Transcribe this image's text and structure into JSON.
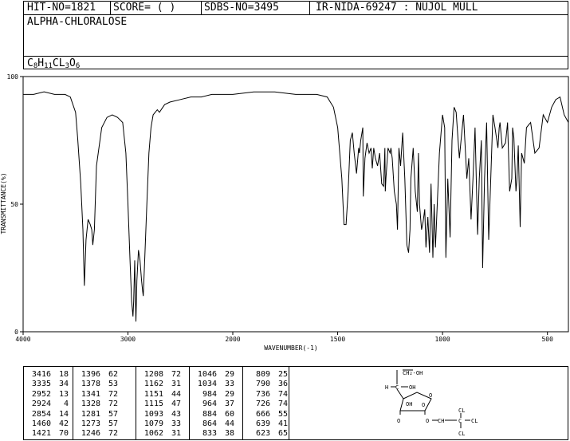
{
  "header": {
    "hit_no": "HIT-NO=1821",
    "score": "SCORE=  (   )",
    "sdbs_no": "SDBS-NO=3495",
    "ir_nida": "IR-NIDA-69247 : NUJOL MULL",
    "compound_name": "ALPHA-CHLORALOSE",
    "formula": {
      "c": "C",
      "c_n": "8",
      "h": "H",
      "h_n": "11",
      "cl": "CL",
      "cl_n": "3",
      "o": "O",
      "o_n": "6"
    }
  },
  "chart_data": {
    "type": "line",
    "title": "",
    "xlabel": "WAVENUMBER(-1)",
    "ylabel": "TRANSMITTANCE(%)",
    "xlim": [
      4000,
      400
    ],
    "ylim": [
      0,
      100
    ],
    "x_ticks": [
      4000,
      3000,
      2000,
      1500,
      1000,
      500
    ],
    "y_ticks": [
      0,
      50,
      100
    ],
    "grid": false,
    "series": [
      {
        "x": [
          4000,
          3900,
          3800,
          3700,
          3600,
          3550,
          3500,
          3480,
          3450,
          3430,
          3416,
          3400,
          3380,
          3360,
          3345,
          3335,
          3320,
          3300,
          3250,
          3200,
          3150,
          3100,
          3050,
          3020,
          3000,
          2980,
          2965,
          2952,
          2945,
          2935,
          2930,
          2924,
          2915,
          2900,
          2885,
          2870,
          2860,
          2854,
          2840,
          2820,
          2800,
          2780,
          2760,
          2720,
          2700,
          2650,
          2600,
          2500,
          2400,
          2300,
          2200,
          2100,
          2000,
          1900,
          1800,
          1700,
          1600,
          1550,
          1520,
          1500,
          1480,
          1470,
          1460,
          1450,
          1440,
          1430,
          1421,
          1410,
          1400,
          1396,
          1390,
          1380,
          1378,
          1370,
          1360,
          1350,
          1341,
          1335,
          1328,
          1320,
          1310,
          1300,
          1290,
          1281,
          1275,
          1273,
          1270,
          1260,
          1250,
          1246,
          1240,
          1230,
          1220,
          1215,
          1208,
          1200,
          1190,
          1180,
          1170,
          1162,
          1155,
          1151,
          1140,
          1130,
          1120,
          1115,
          1110,
          1100,
          1093,
          1085,
          1079,
          1070,
          1062,
          1055,
          1046,
          1040,
          1034,
          1025,
          1015,
          1000,
          990,
          984,
          975,
          964,
          955,
          945,
          935,
          920,
          900,
          884,
          875,
          864,
          855,
          845,
          833,
          825,
          815,
          809,
          800,
          790,
          780,
          770,
          760,
          750,
          736,
          730,
          726,
          715,
          700,
          690,
          680,
          670,
          666,
          660,
          650,
          645,
          639,
          630,
          623,
          610,
          600,
          580,
          560,
          540,
          520,
          500,
          480,
          460,
          440,
          420,
          400
        ],
        "y": [
          93,
          93,
          94,
          93,
          93,
          92,
          86,
          76,
          58,
          40,
          18,
          36,
          44,
          42,
          40,
          34,
          40,
          65,
          80,
          84,
          85,
          84,
          82,
          70,
          50,
          28,
          12,
          6,
          12,
          28,
          15,
          4,
          20,
          32,
          28,
          20,
          16,
          14,
          28,
          50,
          70,
          80,
          85,
          87,
          86,
          89,
          90,
          91,
          92,
          92,
          93,
          93,
          93,
          94,
          94,
          93,
          93,
          92,
          88,
          80,
          60,
          42,
          42,
          55,
          75,
          78,
          70,
          62,
          72,
          70,
          75,
          80,
          53,
          68,
          74,
          70,
          72,
          64,
          72,
          68,
          65,
          70,
          58,
          57,
          72,
          55,
          60,
          72,
          70,
          72,
          68,
          55,
          50,
          40,
          72,
          65,
          78,
          60,
          34,
          31,
          40,
          60,
          72,
          55,
          47,
          70,
          50,
          40,
          43,
          48,
          33,
          45,
          31,
          58,
          29,
          50,
          33,
          50,
          70,
          85,
          80,
          29,
          60,
          37,
          75,
          88,
          86,
          68,
          85,
          60,
          68,
          44,
          60,
          80,
          38,
          60,
          75,
          25,
          60,
          82,
          36,
          60,
          85,
          80,
          72,
          80,
          82,
          72,
          74,
          82,
          55,
          60,
          80,
          76,
          55,
          60,
          73,
          41,
          70,
          66,
          80,
          82,
          70,
          72,
          85,
          82,
          88,
          91,
          92,
          85,
          82
        ]
      }
    ]
  },
  "peak_table": [
    {
      "rows": [
        [
          "3416",
          "18"
        ],
        [
          "3335",
          "34"
        ],
        [
          "2952",
          "13"
        ],
        [
          "2924",
          "4"
        ],
        [
          "2854",
          "14"
        ],
        [
          "1460",
          "42"
        ],
        [
          "1421",
          "70"
        ]
      ]
    },
    {
      "rows": [
        [
          "1396",
          "62"
        ],
        [
          "1378",
          "53"
        ],
        [
          "1341",
          "72"
        ],
        [
          "1328",
          "72"
        ],
        [
          "1281",
          "57"
        ],
        [
          "1273",
          "57"
        ],
        [
          "1246",
          "72"
        ]
      ]
    },
    {
      "rows": [
        [
          "1208",
          "72"
        ],
        [
          "1162",
          "31"
        ],
        [
          "1151",
          "44"
        ],
        [
          "1115",
          "47"
        ],
        [
          "1093",
          "43"
        ],
        [
          "1079",
          "33"
        ],
        [
          "1062",
          "31"
        ]
      ]
    },
    {
      "rows": [
        [
          "1046",
          "29"
        ],
        [
          "1034",
          "33"
        ],
        [
          "984",
          "29"
        ],
        [
          "964",
          "37"
        ],
        [
          "884",
          "60"
        ],
        [
          "864",
          "44"
        ],
        [
          "833",
          "38"
        ]
      ]
    },
    {
      "rows": [
        [
          "809",
          "25"
        ],
        [
          "790",
          "36"
        ],
        [
          "736",
          "74"
        ],
        [
          "726",
          "74"
        ],
        [
          "666",
          "55"
        ],
        [
          "639",
          "41"
        ],
        [
          "623",
          "65"
        ]
      ]
    }
  ],
  "structure_labels": {
    "ch2oh": "CH₂-OH",
    "h1": "H",
    "c1": "C",
    "oh1": "OH",
    "ring_o": "O",
    "oh2": "OH",
    "o2": "O",
    "o3": "O",
    "ch": "CH",
    "c2": "C",
    "cl1": "CL",
    "cl2": "CL",
    "cl3": "CL",
    "h2": "H"
  }
}
